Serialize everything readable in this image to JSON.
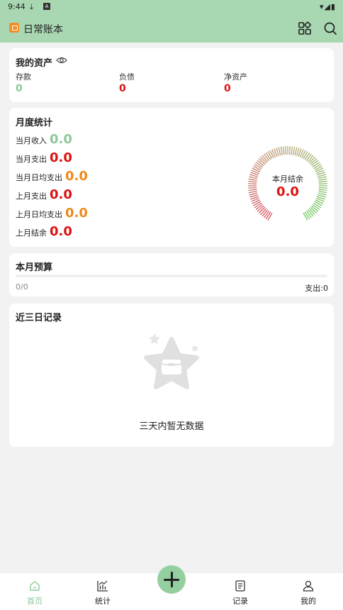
{
  "status_bar": {
    "time": "9:44"
  },
  "app_bar": {
    "title": "日常账本"
  },
  "assets": {
    "title": "我的资产",
    "items": [
      {
        "label": "存款",
        "value": "0"
      },
      {
        "label": "负债",
        "value": "0"
      },
      {
        "label": "净资产",
        "value": "0"
      }
    ]
  },
  "monthly": {
    "title": "月度统计",
    "rows": [
      {
        "label": "当月收入",
        "value": "0.0"
      },
      {
        "label": "当月支出",
        "value": "0.0"
      },
      {
        "label": "当月日均支出",
        "value": "0.0"
      },
      {
        "label": "上月支出",
        "value": "0.0"
      },
      {
        "label": "上月日均支出",
        "value": "0.0"
      },
      {
        "label": "上月结余",
        "value": "0.0"
      }
    ],
    "gauge": {
      "label": "本月结余",
      "value": "0.0"
    }
  },
  "budget": {
    "title": "本月预算",
    "progress": "0/0",
    "spend": "支出:0"
  },
  "recent": {
    "title": "近三日记录",
    "empty_text": "三天内暂无数据"
  },
  "bottom_nav": {
    "items": [
      {
        "label": "首页"
      },
      {
        "label": "统计"
      },
      {
        "label": "记录"
      },
      {
        "label": "我的"
      }
    ]
  },
  "colors": {
    "primary": "#a8d7b2",
    "income_green": "#8ec89a",
    "expense_red": "#dd1111",
    "average_orange": "#ee8a1b"
  }
}
